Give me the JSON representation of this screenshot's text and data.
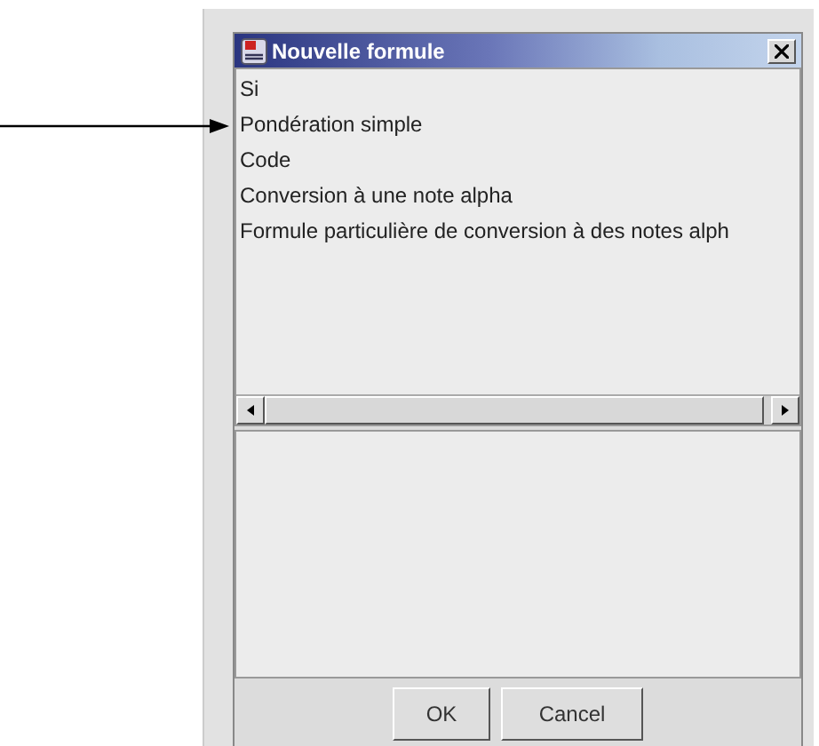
{
  "window": {
    "title": "Nouvelle formule"
  },
  "list": {
    "items": [
      {
        "label": "Si"
      },
      {
        "label": "Pondération simple"
      },
      {
        "label": "Code"
      },
      {
        "label": "Conversion à une note alpha"
      },
      {
        "label": "Formule particulière de conversion à des notes alph"
      }
    ]
  },
  "buttons": [
    "OK",
    "Cancel"
  ]
}
